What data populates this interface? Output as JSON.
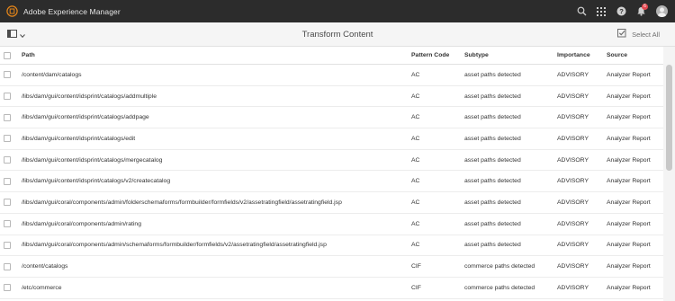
{
  "shell": {
    "app_title": "Adobe Experience Manager",
    "icons": [
      "aem-logo-icon",
      "search-icon",
      "solutions-grid-icon",
      "help-icon",
      "notifications-bell-icon",
      "user-avatar"
    ],
    "notification_count": "6"
  },
  "actionbar": {
    "rail_toggle_icon": "rail-toggle-icon",
    "page_title": "Transform Content",
    "select_all_label": "Select All"
  },
  "table": {
    "columns": {
      "path": "Path",
      "pattern_code": "Pattern Code",
      "subtype": "Subtype",
      "importance": "Importance",
      "source": "Source"
    },
    "rows": [
      {
        "path": "/content/dam/catalogs",
        "code": "AC",
        "subtype": "asset paths detected",
        "importance": "ADVISORY",
        "source": "Analyzer Report"
      },
      {
        "path": "/libs/dam/gui/content/idsprint/catalogs/addmultiple",
        "code": "AC",
        "subtype": "asset paths detected",
        "importance": "ADVISORY",
        "source": "Analyzer Report"
      },
      {
        "path": "/libs/dam/gui/content/idsprint/catalogs/addpage",
        "code": "AC",
        "subtype": "asset paths detected",
        "importance": "ADVISORY",
        "source": "Analyzer Report"
      },
      {
        "path": "/libs/dam/gui/content/idsprint/catalogs/edit",
        "code": "AC",
        "subtype": "asset paths detected",
        "importance": "ADVISORY",
        "source": "Analyzer Report"
      },
      {
        "path": "/libs/dam/gui/content/idsprint/catalogs/mergecatalog",
        "code": "AC",
        "subtype": "asset paths detected",
        "importance": "ADVISORY",
        "source": "Analyzer Report"
      },
      {
        "path": "/libs/dam/gui/content/idsprint/catalogs/v2/createcatalog",
        "code": "AC",
        "subtype": "asset paths detected",
        "importance": "ADVISORY",
        "source": "Analyzer Report"
      },
      {
        "path": "/libs/dam/gui/coral/components/admin/folderschemaforms/formbuilder/formfields/v2/assetratingfield/assetratingfield.jsp",
        "code": "AC",
        "subtype": "asset paths detected",
        "importance": "ADVISORY",
        "source": "Analyzer Report"
      },
      {
        "path": "/libs/dam/gui/coral/components/admin/rating",
        "code": "AC",
        "subtype": "asset paths detected",
        "importance": "ADVISORY",
        "source": "Analyzer Report"
      },
      {
        "path": "/libs/dam/gui/coral/components/admin/schemaforms/formbuilder/formfields/v2/assetratingfield/assetratingfield.jsp",
        "code": "AC",
        "subtype": "asset paths detected",
        "importance": "ADVISORY",
        "source": "Analyzer Report"
      },
      {
        "path": "/content/catalogs",
        "code": "CIF",
        "subtype": "commerce paths detected",
        "importance": "ADVISORY",
        "source": "Analyzer Report"
      },
      {
        "path": "/etc/commerce",
        "code": "CIF",
        "subtype": "commerce paths detected",
        "importance": "ADVISORY",
        "source": "Analyzer Report"
      }
    ]
  },
  "colors": {
    "shell_bg": "#2c2c2c",
    "logo_accent": "#e68619",
    "badge": "#e34850"
  }
}
